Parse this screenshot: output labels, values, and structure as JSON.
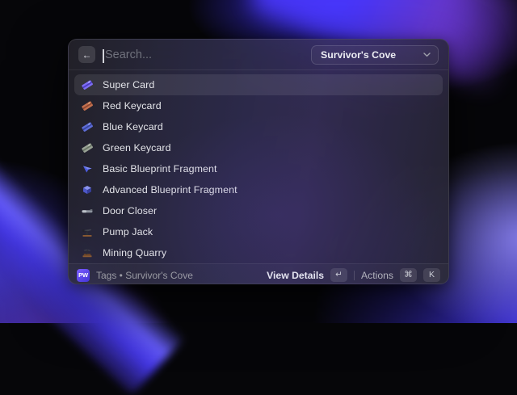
{
  "launcher": {
    "search": {
      "placeholder": "Search..."
    },
    "dropdown": {
      "value": "Survivor's Cove"
    },
    "list": {
      "items": [
        {
          "label": "Super Card",
          "icon": "super-card-icon",
          "selected": true
        },
        {
          "label": "Red Keycard",
          "icon": "red-keycard-icon",
          "selected": false
        },
        {
          "label": "Blue Keycard",
          "icon": "blue-keycard-icon",
          "selected": false
        },
        {
          "label": "Green Keycard",
          "icon": "green-keycard-icon",
          "selected": false
        },
        {
          "label": "Basic Blueprint Fragment",
          "icon": "basic-blueprint-fragment-icon",
          "selected": false
        },
        {
          "label": "Advanced Blueprint Fragment",
          "icon": "advanced-blueprint-fragment-icon",
          "selected": false
        },
        {
          "label": "Door Closer",
          "icon": "door-closer-icon",
          "selected": false
        },
        {
          "label": "Pump Jack",
          "icon": "pump-jack-icon",
          "selected": false
        },
        {
          "label": "Mining Quarry",
          "icon": "mining-quarry-icon",
          "selected": false
        }
      ]
    },
    "footer": {
      "app_badge": "PW",
      "status": "Tags • Survivor's Cove",
      "primary_action": "View Details",
      "primary_key": "↵",
      "secondary_action": "Actions",
      "secondary_keys": [
        "⌘",
        "K"
      ]
    },
    "colors": {
      "selection_highlight": "#ffffff16",
      "app_badge_top": "#7b5cff",
      "app_badge_bottom": "#4334d6",
      "wallpaper_blue": "#4636f0",
      "wallpaper_purple": "#6a3ad0"
    }
  }
}
